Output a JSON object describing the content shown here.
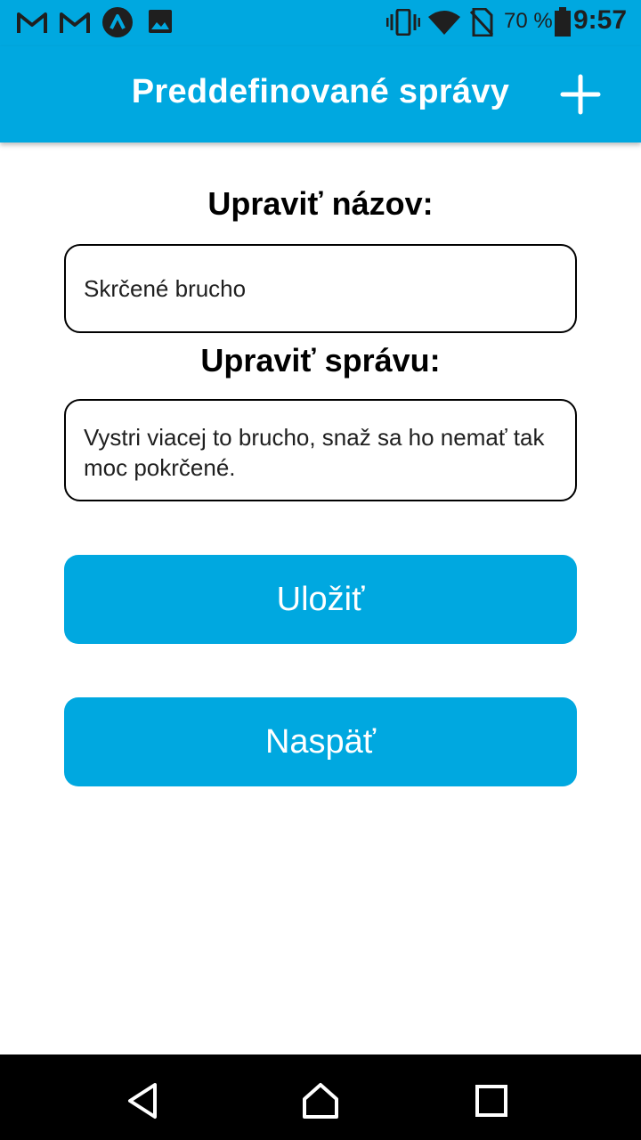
{
  "status_bar": {
    "battery_percent": "70 %",
    "time": "9:57",
    "icons": [
      "gmail-icon",
      "gmail-icon",
      "app-icon",
      "gallery-icon",
      "vibrate-icon",
      "wifi-icon",
      "no-sim-icon",
      "battery-icon"
    ]
  },
  "app_bar": {
    "title": "Preddefinované správy",
    "add_icon": "plus-icon"
  },
  "form": {
    "name_label": "Upraviť názov:",
    "name_value": "Skrčené brucho",
    "message_label": "Upraviť správu:",
    "message_value": "Vystri viacej to brucho, snaž sa ho nemať tak moc pokrčené."
  },
  "buttons": {
    "save": "Uložiť",
    "back": "Naspäť"
  },
  "navigation": {
    "icons": [
      "back-triangle-icon",
      "home-icon",
      "recents-icon"
    ]
  },
  "colors": {
    "accent": "#00a8e0"
  }
}
